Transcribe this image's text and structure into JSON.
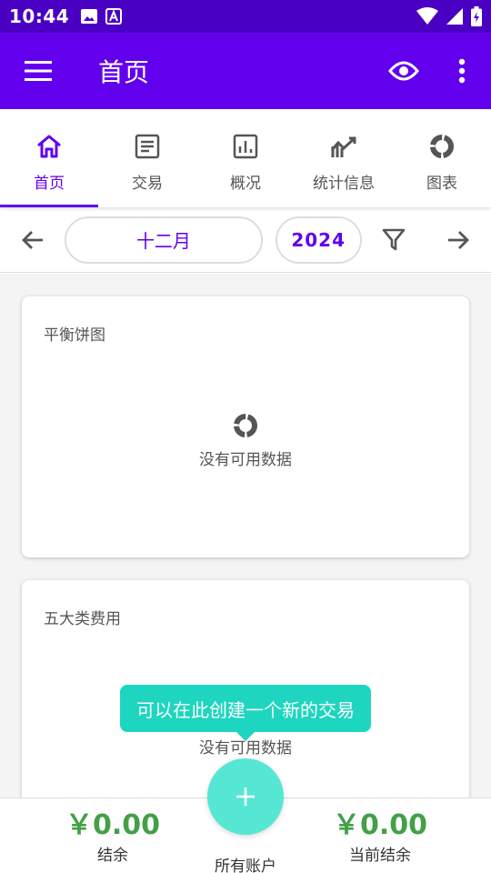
{
  "status_bar": {
    "time": "10:44"
  },
  "appbar": {
    "title": "首页"
  },
  "tabs": [
    {
      "label": "首页",
      "icon": "home-icon",
      "active": true
    },
    {
      "label": "交易",
      "icon": "transactions-icon",
      "active": false
    },
    {
      "label": "概况",
      "icon": "overview-icon",
      "active": false
    },
    {
      "label": "统计信息",
      "icon": "statistics-icon",
      "active": false
    },
    {
      "label": "图表",
      "icon": "chart-icon",
      "active": false
    }
  ],
  "filter": {
    "month": "十二月",
    "year": "2024"
  },
  "cards": [
    {
      "title": "平衡饼图",
      "empty_text": "没有可用数据"
    },
    {
      "title": "五大类费用",
      "empty_text": "没有可用数据"
    }
  ],
  "tooltip": {
    "text": "可以在此创建一个新的交易"
  },
  "bottom": {
    "balance_amount": "￥0.00",
    "balance_label": "结余",
    "current_amount": "￥0.00",
    "current_label": "当前结余",
    "accounts_label": "所有账户"
  },
  "colors": {
    "primary": "#6200ee",
    "status": "#4a00c2",
    "accent": "#1ed6bf",
    "fab": "#56e6d4",
    "money": "#43a047"
  }
}
